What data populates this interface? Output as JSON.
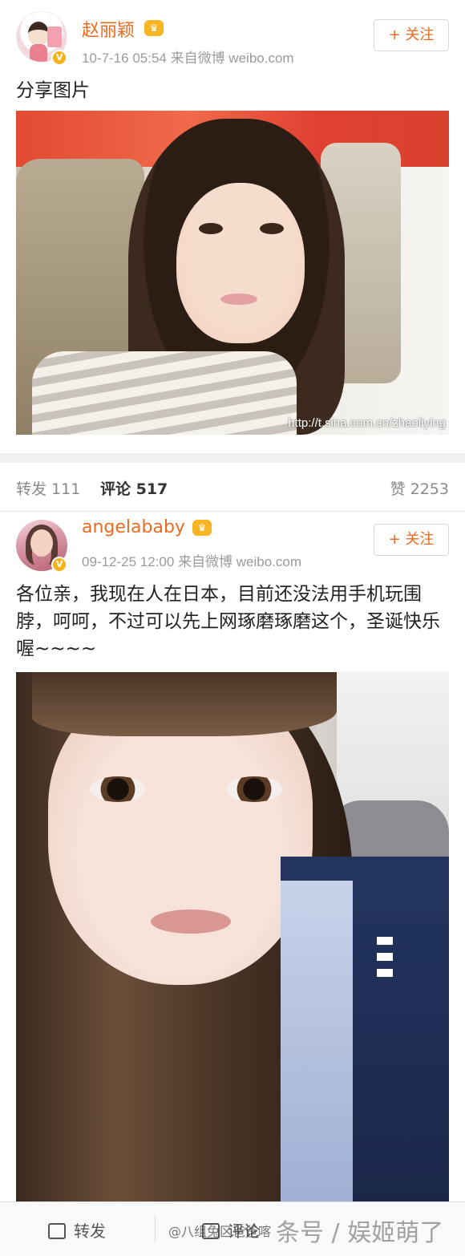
{
  "post1": {
    "username": "赵丽颖",
    "meta": "10-7-16 05:54 来自微博 weibo.com",
    "follow_label": "+ 关注",
    "text": "分享图片",
    "photo_watermark": "http://t.sina.com.cn/zhaoliying"
  },
  "stats": {
    "repost": "转发 111",
    "comment": "评论 517",
    "like": "赞 2253"
  },
  "post2": {
    "username": "angelababy",
    "meta": "09-12-25 12:00 来自微博 weibo.com",
    "follow_label": "+ 关注",
    "text": "各位亲，我现在人在日本，目前还没法用手机玩围脖，呵呵，不过可以先上网琢磨琢磨这个，圣诞快乐喔~~~~"
  },
  "bottom_bar": {
    "repost_label": "转发",
    "comment_label": "评论"
  },
  "footer_watermark": {
    "handle": "@八组兔区爸爸喀",
    "brand": "条号 / 娱姬萌了"
  }
}
